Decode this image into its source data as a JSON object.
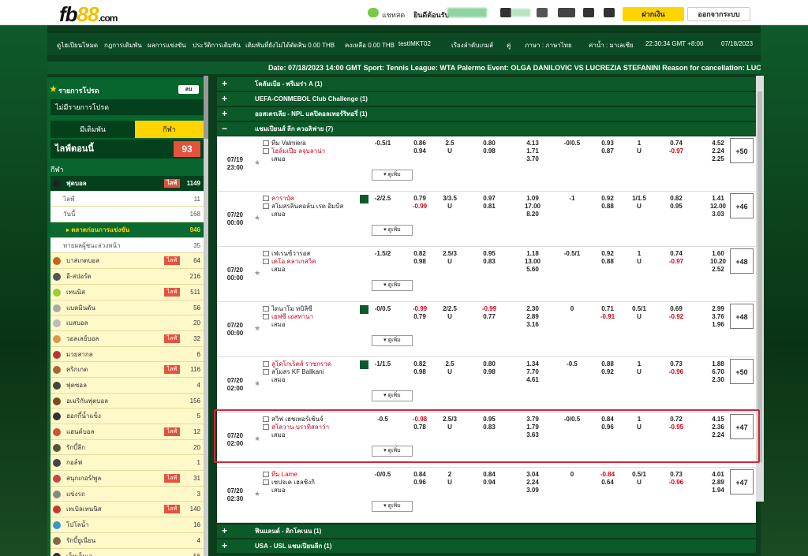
{
  "header": {
    "logo_fb": "fb",
    "logo_88": "88",
    "logo_com": ".com",
    "chat_label": "แชทสด",
    "welcome": "ยินดีต้อนรับ",
    "deposit": "ฝากเงิน",
    "logout": "ออกจากระบบ"
  },
  "nav": {
    "items": [
      "ดูไฮเปียนโหมด",
      "กฎการเดิมพัน",
      "ผลการแข่งขัน",
      "ประวัติการเดิมพัน",
      "เดิมพันที่ยังไม่ได้ตัดสิน 0.00 THB",
      "คงเหลือ 0.00 THB",
      "testIMKT02"
    ],
    "order": "เรียงลำดับเกมส์",
    "pair": "คู่",
    "lang": "ภาษา : ภาษาไทย",
    "odds": "ค่าน้ำ : มาเลเซีย",
    "time": "22:30:34 GMT +8:00",
    "date": "07/18/2023"
  },
  "ticker": "Date: 07/18/2023 14:00 GMT Sport: Tennis League: WTA Palermo Event: OLGA DANILOVIC VS LUCREZIA STEFANINI Reason for cancellation: LUCREZ",
  "sidebar": {
    "fav_title": "รายการโปรด",
    "fav_btn": "ลบ",
    "no_fav": "ไม่มีรายการโปรด",
    "tab_bet": "มีเดิมพัน",
    "tab_sport": "กีฬา",
    "live_today": "ไลฟ์ตอนนี้",
    "live_count": "93",
    "sports_label": "กีฬา",
    "rows": [
      {
        "label": "ฟุตบอล",
        "live": "ไลฟ์",
        "count": "1149",
        "style": "dark"
      },
      {
        "label": "ไลฟ์",
        "live": "",
        "count": "11",
        "style": "sub"
      },
      {
        "label": "วันนี้",
        "live": "",
        "count": "168",
        "style": "sub"
      },
      {
        "label": "▸ ตลาดก่อนการแข่งขัน",
        "live": "",
        "count": "946",
        "style": "act"
      },
      {
        "label": "ทายผลผู้ชนะล่วงหน้า",
        "live": "",
        "count": "35",
        "style": "sub"
      },
      {
        "label": "บาสเกตบอล",
        "live": "ไลฟ์",
        "count": "64",
        "style": ""
      },
      {
        "label": "อี-สปอร์ต",
        "live": "",
        "count": "216",
        "style": ""
      },
      {
        "label": "เทนนิส",
        "live": "ไลฟ์",
        "count": "511",
        "style": ""
      },
      {
        "label": "แบดมินตัน",
        "live": "",
        "count": "56",
        "style": ""
      },
      {
        "label": "เบสบอล",
        "live": "",
        "count": "20",
        "style": ""
      },
      {
        "label": "วอลเลย์บอล",
        "live": "ไลฟ์",
        "count": "32",
        "style": ""
      },
      {
        "label": "มวยสากล",
        "live": "",
        "count": "6",
        "style": ""
      },
      {
        "label": "คริกเกต",
        "live": "ไลฟ์",
        "count": "116",
        "style": ""
      },
      {
        "label": "ฟุตซอล",
        "live": "",
        "count": "4",
        "style": ""
      },
      {
        "label": "อเมริกันฟุตบอล",
        "live": "",
        "count": "156",
        "style": ""
      },
      {
        "label": "ฮอกกี้น้ำแข็ง",
        "live": "",
        "count": "5",
        "style": ""
      },
      {
        "label": "แฮนด์บอล",
        "live": "ไลฟ์",
        "count": "12",
        "style": ""
      },
      {
        "label": "รักบี้ลีก",
        "live": "",
        "count": "20",
        "style": ""
      },
      {
        "label": "กอล์ฟ",
        "live": "",
        "count": "1",
        "style": ""
      },
      {
        "label": "สนุกเกอร์/พูล",
        "live": "ไลฟ์",
        "count": "31",
        "style": ""
      },
      {
        "label": "แข่งรถ",
        "live": "",
        "count": "3",
        "style": ""
      },
      {
        "label": "เทเบิลเทนนิส",
        "live": "ไลฟ์",
        "count": "140",
        "style": ""
      },
      {
        "label": "โปโลน้ำ",
        "live": "",
        "count": "16",
        "style": ""
      },
      {
        "label": "รักบี้ยูเนียน",
        "live": "",
        "count": "4",
        "style": ""
      },
      {
        "label": "เอ็มเอ็มเอ",
        "live": "",
        "count": "56",
        "style": ""
      }
    ]
  },
  "leagues_top": [
    {
      "label": "โคลัมเบีย - พรีเมร่า A (1)",
      "sign": "+"
    },
    {
      "label": "UEFA-CONMEBOL Club Challenge (1)",
      "sign": "+"
    },
    {
      "label": "ออสเตรเลีย - NPL แคปิตอลเทอร์ริทอรี่ (1)",
      "sign": "+"
    },
    {
      "label": "แชมเปียนส์ ลีก ควอลิฟาย (7)",
      "sign": "−"
    }
  ],
  "more_label": "▾ ดูเพิ่ม",
  "matches": [
    {
      "date": "07/19",
      "time": "23:00",
      "home": "ทีม Valmiera",
      "away": "โฮล์มเปีย ลจุบลาน่า",
      "draw": "เสมอ",
      "hdp": [
        "",
        "-0.5/1"
      ],
      "o1": [
        "0.86",
        "0.94"
      ],
      "ou": [
        "2.5",
        "U"
      ],
      "o2": [
        "0.80",
        "0.98"
      ],
      "x12": [
        "4.13",
        "1.71",
        "3.70"
      ],
      "hdp2": [
        "",
        "-0/0.5"
      ],
      "o3": [
        "0.93",
        "0.87"
      ],
      "ou2": [
        "1",
        "U"
      ],
      "o4": [
        "0.74",
        "-0.97"
      ],
      "x12b": [
        "4.52",
        "2.24",
        "2.25"
      ],
      "more": "+50"
    },
    {
      "date": "07/20",
      "time": "00:00",
      "home": "คาราบัค",
      "away": "สโมสรลินคอล์น เรด อิมป์ส",
      "draw": "เสมอ",
      "hdp": [
        "-2/2.5",
        ""
      ],
      "o1": [
        "0.79",
        "-0.99"
      ],
      "ou": [
        "3/3.5",
        "U"
      ],
      "o2": [
        "0.97",
        "0.81"
      ],
      "x12": [
        "1.09",
        "17.00",
        "8.20"
      ],
      "hdp2": [
        "-1",
        ""
      ],
      "o3": [
        "0.92",
        "0.88"
      ],
      "ou2": [
        "1/1.5",
        "U"
      ],
      "o4": [
        "0.82",
        "0.95"
      ],
      "x12b": [
        "1.41",
        "12.00",
        "3.03"
      ],
      "more": "+46"
    },
    {
      "date": "07/20",
      "time": "00:00",
      "home": "เฟเรนซ์วารอส",
      "away": "เคโอ คลาเกสวิค",
      "draw": "เสมอ",
      "hdp": [
        "-1.5/2",
        ""
      ],
      "o1": [
        "0.82",
        "0.98"
      ],
      "ou": [
        "2.5/3",
        "U"
      ],
      "o2": [
        "0.95",
        "0.83"
      ],
      "x12": [
        "1.18",
        "13.00",
        "5.60"
      ],
      "hdp2": [
        "-0.5/1",
        ""
      ],
      "o3": [
        "0.92",
        "0.88"
      ],
      "ou2": [
        "1",
        "U"
      ],
      "o4": [
        "0.74",
        "-0.97"
      ],
      "x12b": [
        "1.60",
        "10.20",
        "2.52"
      ],
      "more": "+48"
    },
    {
      "date": "07/20",
      "time": "00:00",
      "home": "ไดนาโม ทบิลิซี",
      "away": "เฮฟซี เอสทานา",
      "draw": "เสมอ",
      "hdp": [
        "-0/0.5",
        ""
      ],
      "o1": [
        "-0.99",
        "0.79"
      ],
      "ou": [
        "2/2.5",
        "U"
      ],
      "o2": [
        "-0.99",
        "0.77"
      ],
      "x12": [
        "2.30",
        "2.89",
        "3.16"
      ],
      "hdp2": [
        "0",
        ""
      ],
      "o3": [
        "0.71",
        "-0.91"
      ],
      "ou2": [
        "0.5/1",
        "U"
      ],
      "o4": [
        "0.69",
        "-0.92"
      ],
      "x12b": [
        "2.99",
        "3.76",
        "1.96"
      ],
      "more": "+48"
    },
    {
      "date": "07/20",
      "time": "02:00",
      "home": "ลูโดโกเร็ตส์ ราซกราด",
      "away": "สโมสร KF Ballkani",
      "draw": "เสมอ",
      "hdp": [
        "-1/1.5",
        ""
      ],
      "o1": [
        "0.82",
        "0.98"
      ],
      "ou": [
        "2.5",
        "U"
      ],
      "o2": [
        "0.80",
        "0.98"
      ],
      "x12": [
        "1.34",
        "7.70",
        "4.61"
      ],
      "hdp2": [
        "-0.5",
        ""
      ],
      "o3": [
        "0.88",
        "0.92"
      ],
      "ou2": [
        "1",
        "U"
      ],
      "o4": [
        "0.73",
        "-0.96"
      ],
      "x12b": [
        "1.88",
        "6.70",
        "2.30"
      ],
      "more": "+50"
    },
    {
      "date": "07/20",
      "time": "02:00",
      "home": "สวิฟ เฮชเพอร์เช้นจ์",
      "away": "สโลวาน บราทิสลาว่า",
      "draw": "เสมอ",
      "hdp": [
        "",
        "-0.5"
      ],
      "o1": [
        "-0.98",
        "0.78"
      ],
      "ou": [
        "2.5/3",
        "U"
      ],
      "o2": [
        "0.95",
        "0.83"
      ],
      "x12": [
        "3.79",
        "1.79",
        "3.63"
      ],
      "hdp2": [
        "",
        "-0/0.5"
      ],
      "o3": [
        "0.84",
        "0.96"
      ],
      "ou2": [
        "1",
        "U"
      ],
      "o4": [
        "0.72",
        "-0.95"
      ],
      "x12b": [
        "4.15",
        "2.36",
        "2.24"
      ],
      "more": "+47"
    },
    {
      "date": "07/20",
      "time": "02:30",
      "home": "ทีม Lame",
      "away": "เซปจเค เฮลซิงกิ",
      "draw": "เสมอ",
      "hdp": [
        "",
        "-0/0.5"
      ],
      "o1": [
        "0.84",
        "0.96"
      ],
      "ou": [
        "2",
        "U"
      ],
      "o2": [
        "0.84",
        "0.94"
      ],
      "x12": [
        "3.04",
        "2.24",
        "3.09"
      ],
      "hdp2": [
        "",
        "0"
      ],
      "o3": [
        "-0.84",
        "0.64"
      ],
      "ou2": [
        "0.5/1",
        "U"
      ],
      "o4": [
        "0.73",
        "-0.96"
      ],
      "x12b": [
        "4.01",
        "2.89",
        "1.94"
      ],
      "more": "+47"
    }
  ],
  "leagues_bottom": [
    {
      "label": "ฟินแลนด์ - ดิกโคเนน (1)",
      "sign": "+"
    },
    {
      "label": "USA - USL แชมเปียนลีก (1)",
      "sign": "+"
    }
  ]
}
